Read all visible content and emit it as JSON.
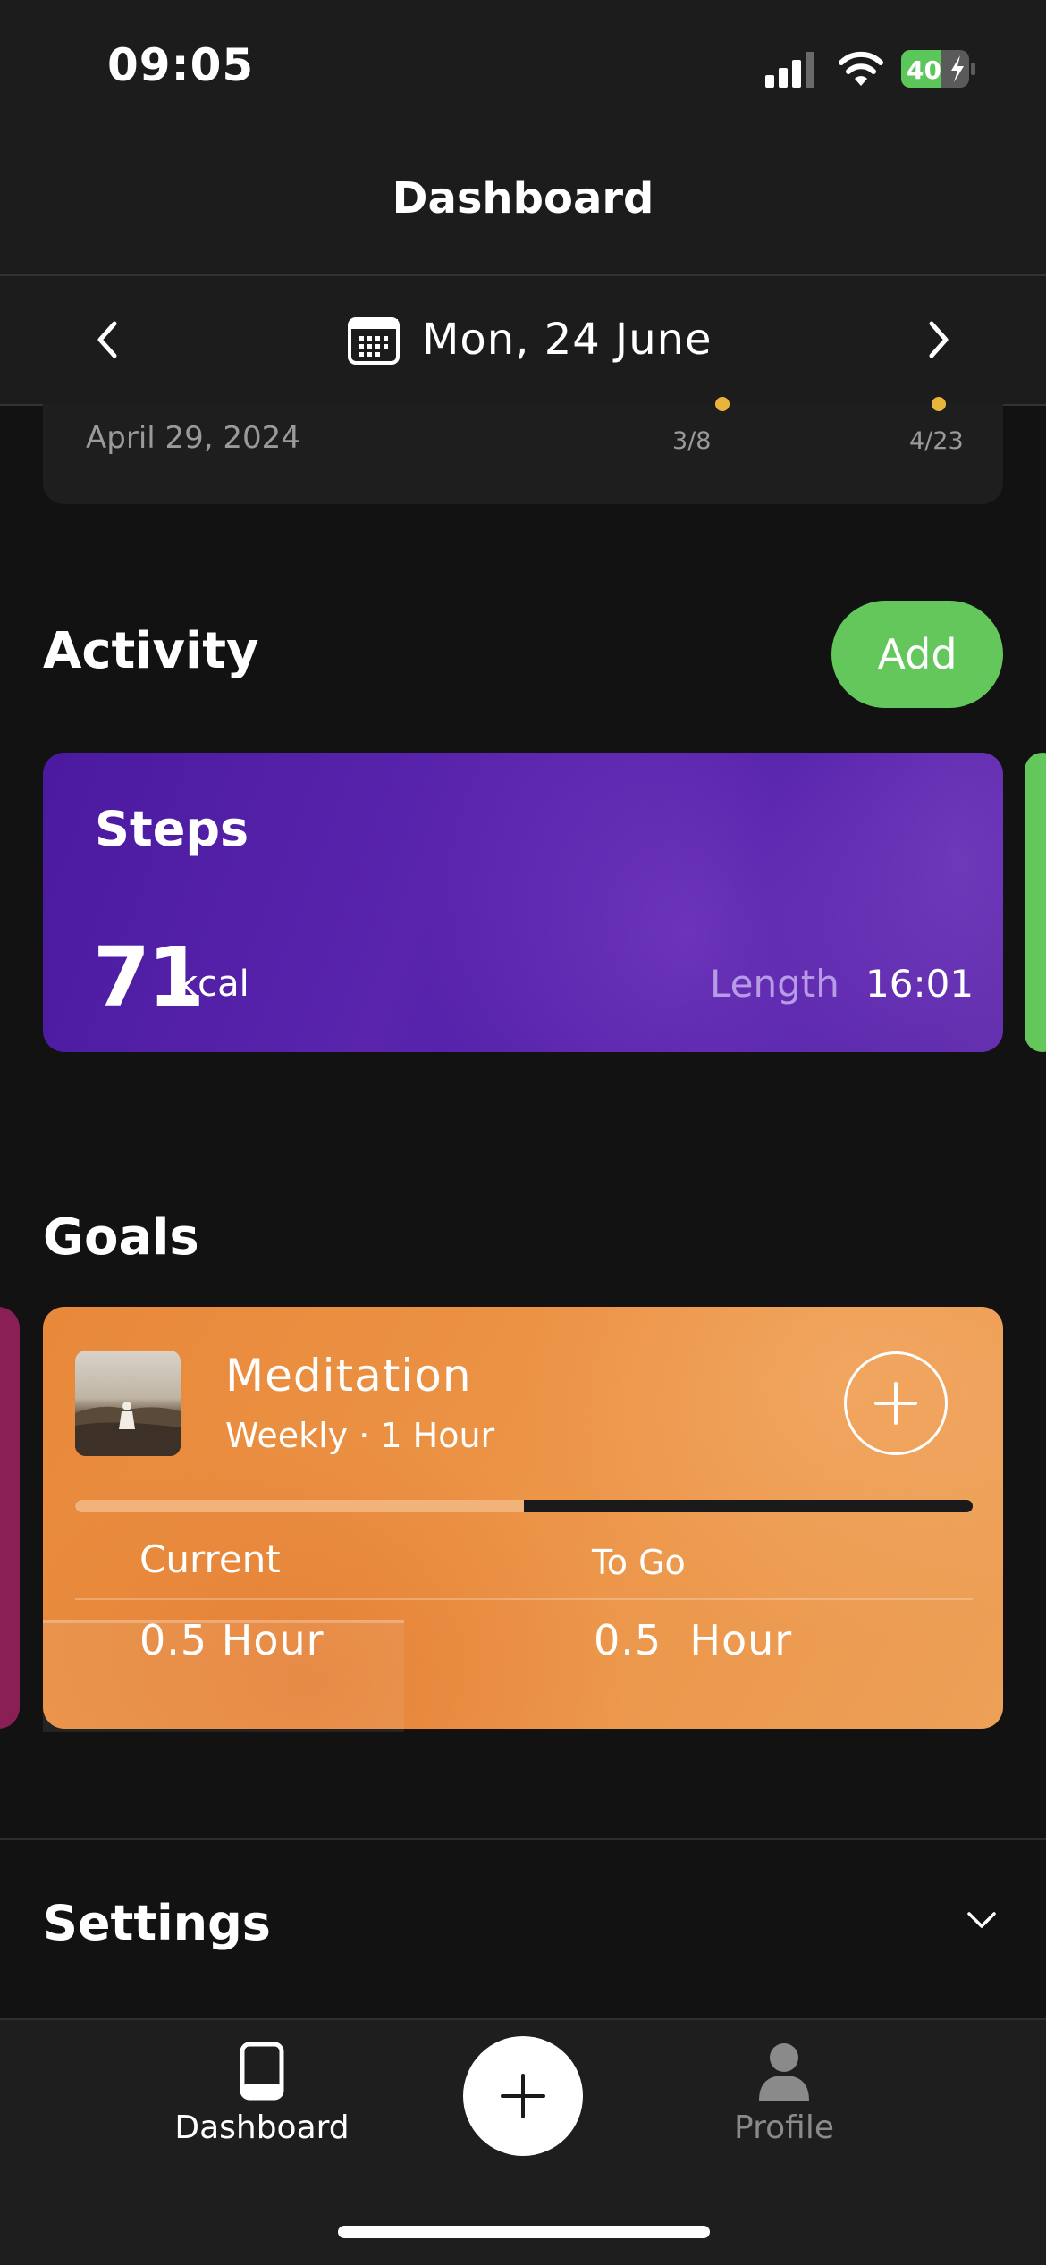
{
  "status_bar": {
    "time": "09:05",
    "battery": "40"
  },
  "header": {
    "title": "Dashboard"
  },
  "date_nav": {
    "date": "Mon, 24 June"
  },
  "partial_card": {
    "date": "April 29, 2024",
    "marker_1": "3/8",
    "marker_2": "4/23"
  },
  "activity": {
    "title": "Activity",
    "add_label": "Add",
    "card": {
      "title": "Steps",
      "value": "71",
      "unit": "kcal",
      "length_label": "Length",
      "length_value": "16:01"
    }
  },
  "goals": {
    "title": "Goals",
    "card": {
      "title": "Meditation",
      "subtitle": "Weekly · 1 Hour",
      "progress": 0.5,
      "current_label": "Current",
      "current_value": "0.5 Hour",
      "togo_label": "To Go",
      "togo_value": "0.5  Hour"
    }
  },
  "settings": {
    "title": "Settings"
  },
  "tab_bar": {
    "dashboard_label": "Dashboard",
    "profile_label": "Profile"
  },
  "colors": {
    "background": "#121212",
    "accent_green": "#63c75b",
    "steps_purple": "#4a1aa0",
    "goal_orange": "#e8883a",
    "goal_pink": "#8a1f55"
  }
}
